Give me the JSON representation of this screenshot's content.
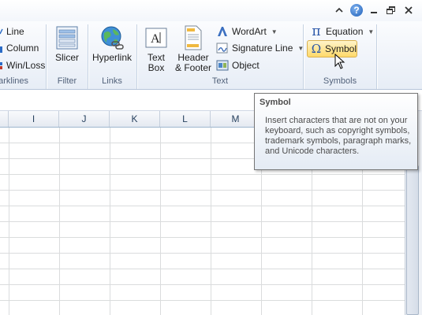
{
  "window_controls": {
    "help_label": "?"
  },
  "ribbon": {
    "sparklines": {
      "items": [
        "Line",
        "Column",
        "Win/Loss"
      ],
      "group_label": "parklines"
    },
    "filter": {
      "slicer_label": "Slicer",
      "group_label": "Filter"
    },
    "links": {
      "hyperlink_label": "Hyperlink",
      "group_label": "Links"
    },
    "text": {
      "textbox_label_1": "Text",
      "textbox_label_2": "Box",
      "header_label_1": "Header",
      "header_label_2": "& Footer",
      "wordart_label": "WordArt",
      "signature_label": "Signature Line",
      "object_label": "Object",
      "group_label": "Text"
    },
    "symbols": {
      "equation_label": "Equation",
      "equation_glyph": "π",
      "symbol_label": "Symbol",
      "symbol_glyph": "Ω",
      "group_label": "Symbols"
    }
  },
  "sheet": {
    "columns": [
      "I",
      "J",
      "K",
      "L",
      "M"
    ]
  },
  "tooltip": {
    "title": "Symbol",
    "body": "Insert characters that are not on your keyboard, such as copyright symbols, trademark symbols, paragraph marks, and Unicode characters."
  },
  "colors": {
    "ribbon_bg": "#e7edf6",
    "highlight": "#ffd96a",
    "grid_line": "#dadcdd"
  }
}
